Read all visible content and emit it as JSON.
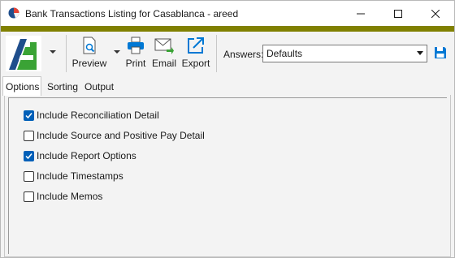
{
  "window": {
    "title": "Bank Transactions Listing for Casablanca - areed",
    "accent_color": "#808000"
  },
  "toolbar": {
    "preview_label": "Preview",
    "print_label": "Print",
    "email_label": "Email",
    "export_label": "Export",
    "answers_label": "Answers:",
    "answers_value": "Defaults"
  },
  "tabs": [
    {
      "label": "Options",
      "active": true
    },
    {
      "label": "Sorting",
      "active": false
    },
    {
      "label": "Output",
      "active": false
    }
  ],
  "options": [
    {
      "label": "Include Reconciliation Detail",
      "checked": true
    },
    {
      "label": "Include Source and Positive Pay Detail",
      "checked": false
    },
    {
      "label": "Include Report Options",
      "checked": true
    },
    {
      "label": "Include Timestamps",
      "checked": false
    },
    {
      "label": "Include Memos",
      "checked": false
    }
  ],
  "colors": {
    "checkbox_checked": "#005fb8",
    "logo_green": "#3aa335",
    "logo_blue": "#1f4e8c",
    "icon_blue": "#0078d4"
  }
}
